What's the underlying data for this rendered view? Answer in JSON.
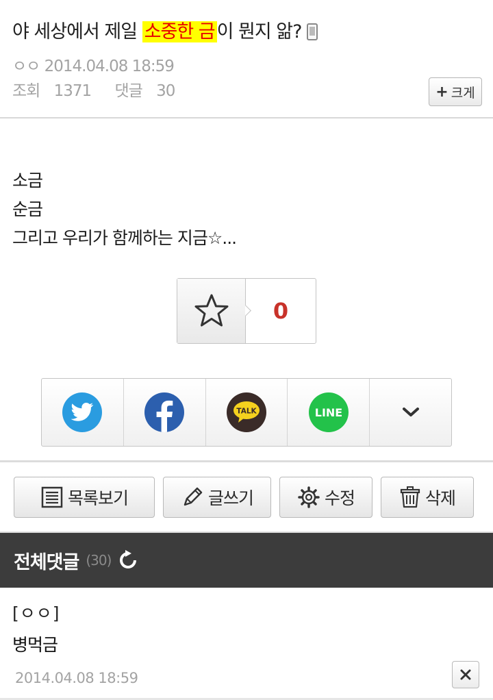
{
  "post": {
    "title_before": "야 세상에서 제일 ",
    "title_highlight": "소중한 금",
    "title_after": "이 뭔지 앎?",
    "author": "ㅇㅇ",
    "datetime": "2014.04.08 18:59",
    "views_label": "조회",
    "views": "1371",
    "comments_label": "댓글",
    "comments": "30",
    "enlarge_plus": "+",
    "enlarge_label": "크게",
    "content_lines": [
      "소금",
      "순금",
      "그리고 우리가 함께하는 지금☆..."
    ]
  },
  "recommend": {
    "icon": "star-icon",
    "count": "0"
  },
  "share": {
    "items": [
      "twitter-icon",
      "facebook-icon",
      "kakaotalk-icon",
      "line-icon",
      "chevron-down-icon"
    ],
    "kakao_text": "TALK",
    "line_text": "LINE",
    "colors": {
      "twitter": "#2a9ce0",
      "facebook": "#2c5fae",
      "kakao": "#3a2b28",
      "kakao_bubble": "#f5d11e",
      "line": "#23c24a"
    }
  },
  "actions": {
    "list_label": "목록보기",
    "write_label": "글쓰기",
    "edit_label": "수정",
    "delete_label": "삭제"
  },
  "comments_section": {
    "title": "전체댓글",
    "count": "(30)"
  },
  "comment": {
    "author": "[ㅇㅇ]",
    "body": "병먹금",
    "datetime": "2014.04.08 18:59"
  },
  "colors": {
    "highlight_bg": "#ffff00",
    "highlight_text": "#e60000",
    "recommend_count": "#c8322a",
    "comment_header_bg": "#3c3c3c"
  }
}
